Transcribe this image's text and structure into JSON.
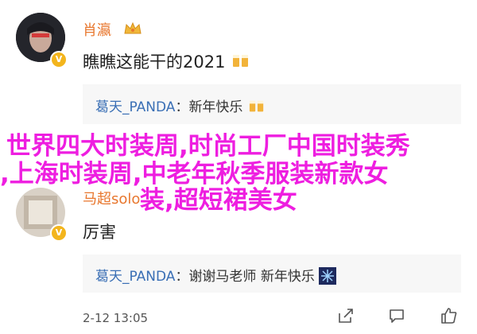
{
  "comments": [
    {
      "username": "肖瀛",
      "text": "瞧瞧这能干的2021",
      "reply": {
        "name": "葛天_PANDA",
        "text": "新年快乐"
      }
    },
    {
      "username": "马超solo",
      "text": "厉害",
      "reply": {
        "name": "葛天_PANDA",
        "text": "谢谢马老师 新年快乐"
      }
    }
  ],
  "footer": {
    "time": "2-12 13:05"
  },
  "overlay": {
    "line1": "世界四大时装周,时尚工厂中国时装秀",
    "line2": ",上海时装周,中老年秋季服装新款女",
    "line3": "装,超短裙美女"
  },
  "colors": {
    "username": "#e8772e",
    "reply_name": "#3a6fb5",
    "overlay": "#ee1ee0",
    "verified": "#f3b51d"
  }
}
